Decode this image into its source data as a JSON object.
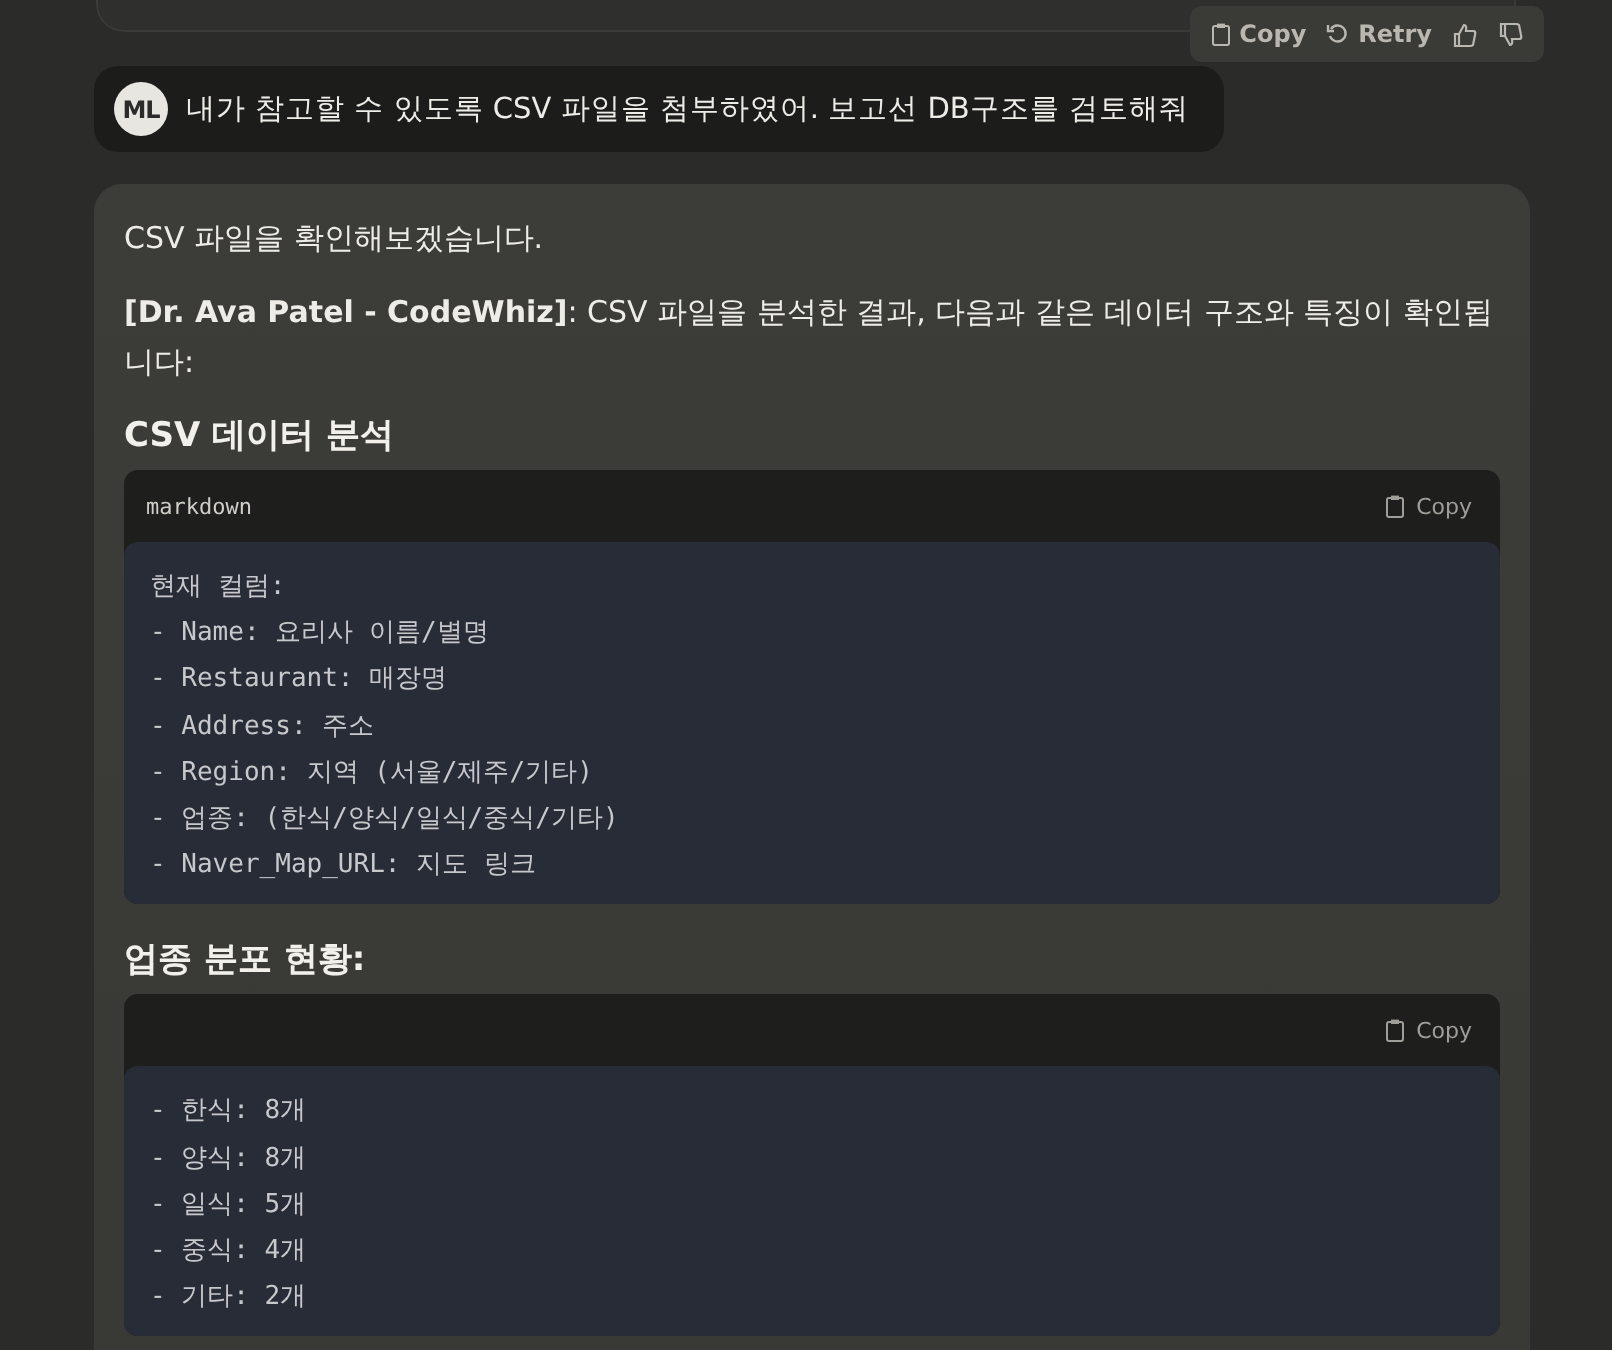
{
  "actions": [
    {
      "kind": "copy",
      "label": "Copy"
    },
    {
      "kind": "retry",
      "label": "Retry"
    },
    {
      "kind": "like"
    },
    {
      "kind": "dislike"
    }
  ],
  "user_message": {
    "avatar": "ML",
    "text": "내가 참고할 수 있도록 CSV 파일을 첨부하였어. 보고선 DB구조를 검토해줘"
  },
  "assistant_message": {
    "blocks": [
      {
        "kind": "paragraph",
        "text": "CSV 파일을 확인해보겠습니다."
      },
      {
        "kind": "paragraph",
        "text": "**[Dr. Ava Patel - CodeWhiz]**: CSV 파일을 분석한 결과, 다음과 같은 데이터 구조와 특징이 확인됩니다:"
      },
      {
        "kind": "heading",
        "text": "CSV 데이터 분석"
      },
      {
        "kind": "code",
        "language": "markdown",
        "copy_label": "Copy",
        "lines": [
          "현재 컬럼:",
          "- Name: 요리사 이름/별명",
          "- Restaurant: 매장명",
          "- Address: 주소",
          "- Region: 지역 (서울/제주/기타)",
          "- 업종: (한식/양식/일식/중식/기타)",
          "- Naver_Map_URL: 지도 링크"
        ]
      },
      {
        "kind": "heading",
        "text": "업종 분포 현황:"
      },
      {
        "kind": "code",
        "copy_label": "Copy",
        "lines": [
          "- 한식: 8개",
          "- 양식: 8개",
          "- 일식: 5개",
          "- 중식: 4개",
          "- 기타: 2개"
        ]
      }
    ]
  }
}
